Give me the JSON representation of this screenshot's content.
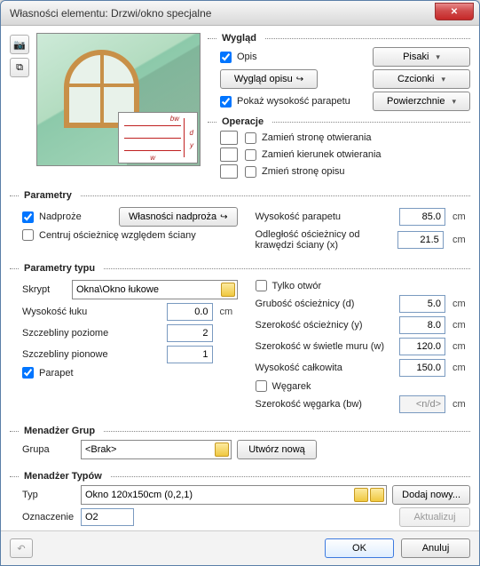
{
  "window": {
    "title": "Własności elementu: Drzwi/okno specjalne"
  },
  "icons": {
    "camera": "📷",
    "copy": "⧉",
    "close": "✕",
    "undo": "↶"
  },
  "appearance": {
    "title": "Wygląd",
    "opis_label": "Opis",
    "opis_checked": true,
    "wyglad_opisu_btn": "Wygląd opisu",
    "pokaz_wys_label": "Pokaż wysokość parapetu",
    "pokaz_wys_checked": true,
    "pisaki_btn": "Pisaki",
    "czcionki_btn": "Czcionki",
    "powierzchnie_btn": "Powierzchnie"
  },
  "ops": {
    "title": "Operacje",
    "op1_label": "Zamień stronę otwierania",
    "op2_label": "Zamień kierunek otwierania",
    "op3_label": "Zmień stronę opisu"
  },
  "params": {
    "title": "Parametry",
    "nadproze_label": "Nadproże",
    "nadproze_checked": true,
    "wlasnosci_nadproza_btn": "Własności nadproża",
    "centruj_label": "Centruj ościeżnicę względem ściany",
    "centruj_checked": false,
    "wys_parapetu_label": "Wysokość parapetu",
    "wys_parapetu_val": "85.0",
    "odl_label": "Odległość ościeżnicy od krawędzi ściany (x)",
    "odl_val": "21.5",
    "unit": "cm"
  },
  "type": {
    "title": "Parametry typu",
    "skrypt_label": "Skrypt",
    "skrypt_val": "Okna\\Okno łukowe",
    "wys_luku_label": "Wysokość łuku",
    "wys_luku_val": "0.0",
    "szcz_poz_label": "Szczebliny poziome",
    "szcz_poz_val": "2",
    "szcz_pion_label": "Szczebliny pionowe",
    "szcz_pion_val": "1",
    "parapet_label": "Parapet",
    "parapet_checked": true,
    "tylko_otwor_label": "Tylko otwór",
    "tylko_otwor_checked": false,
    "grub_d_label": "Grubość ościeżnicy (d)",
    "grub_d_val": "5.0",
    "szer_y_label": "Szerokość ościeżnicy (y)",
    "szer_y_val": "8.0",
    "szer_w_label": "Szerokość w świetle muru (w)",
    "szer_w_val": "120.0",
    "wys_calk_label": "Wysokość całkowita",
    "wys_calk_val": "150.0",
    "wegarek_label": "Węgarek",
    "wegarek_checked": false,
    "szer_weg_label": "Szerokość węgarka (bw)",
    "szer_weg_val": "<n/d>",
    "unit": "cm"
  },
  "groups": {
    "title": "Menadżer Grup",
    "grupa_label": "Grupa",
    "grupa_val": "<Brak>",
    "utworz_btn": "Utwórz nową"
  },
  "types": {
    "title": "Menadżer Typów",
    "typ_label": "Typ",
    "typ_val": "Okno 120x150cm (0,2,1)",
    "oznaczenie_label": "Oznaczenie",
    "oznaczenie_val": "O2",
    "dodaj_btn": "Dodaj nowy...",
    "aktualizuj_btn": "Aktualizuj"
  },
  "buttons": {
    "ok": "OK",
    "cancel": "Anuluj"
  },
  "dim_labels": {
    "bw": "bw",
    "d": "d",
    "y": "y",
    "w": "w"
  }
}
